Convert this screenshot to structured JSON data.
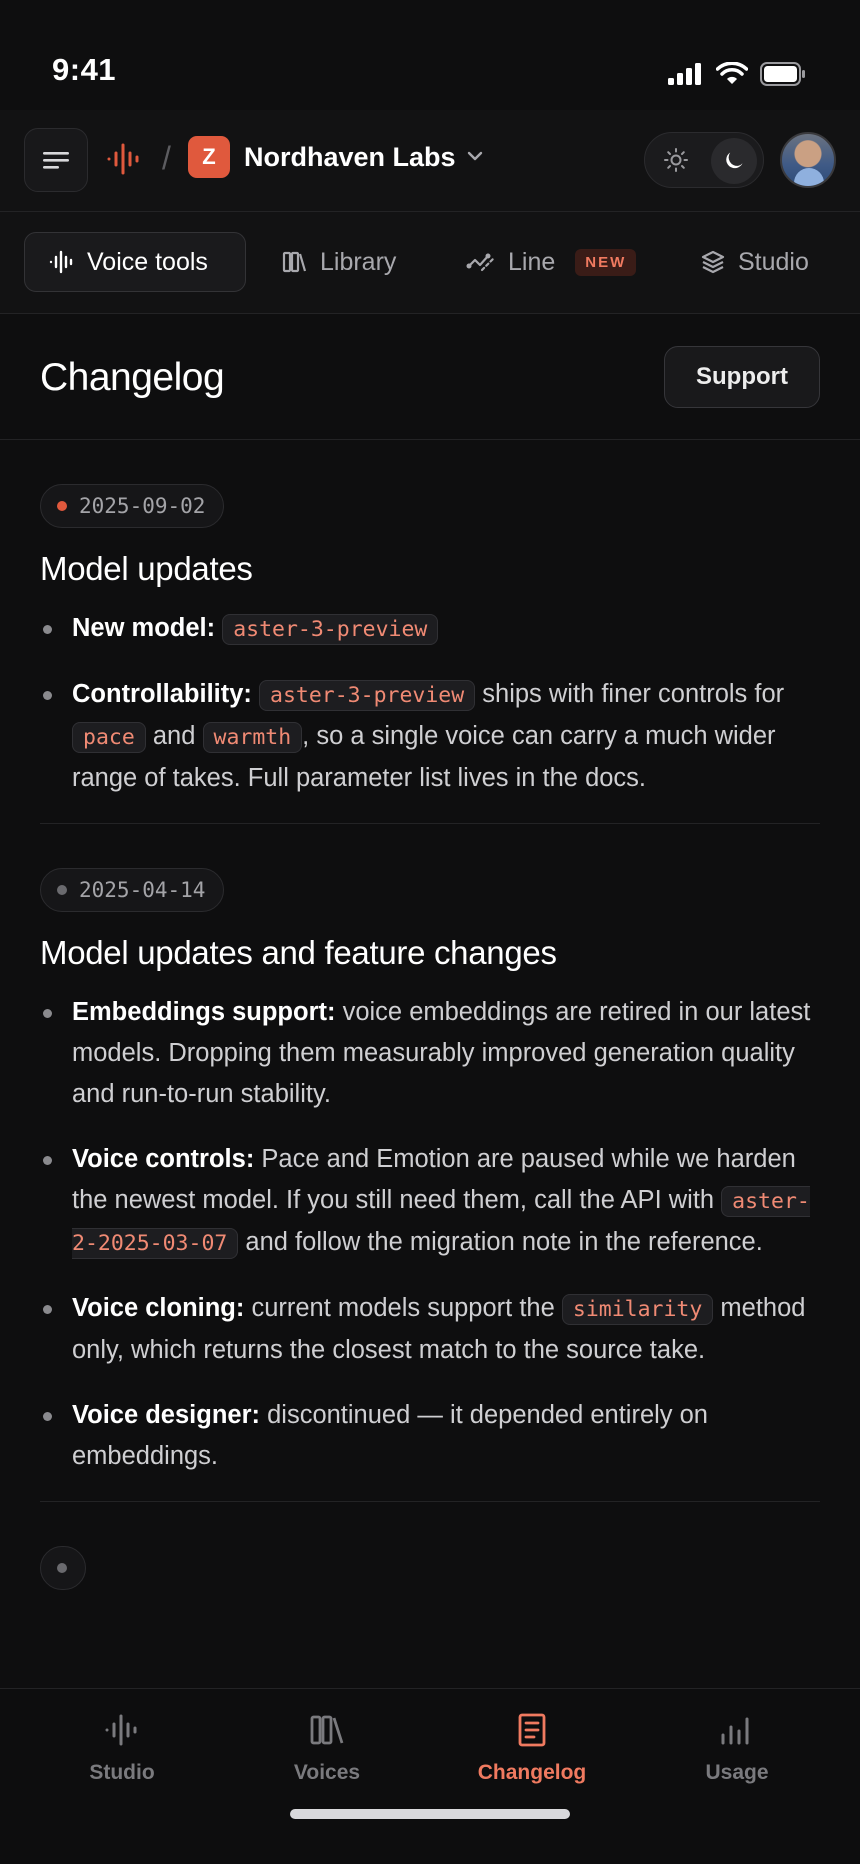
{
  "status_bar": {
    "time": "9:41"
  },
  "header": {
    "org_initial": "Z",
    "org_name": "Nordhaven Labs"
  },
  "tabs": [
    {
      "label": "Voice tools",
      "icon": "waveform-icon",
      "active": true
    },
    {
      "label": "Library",
      "icon": "library-icon",
      "active": false
    },
    {
      "label": "Line",
      "icon": "line-icon",
      "active": false,
      "badge": "NEW"
    },
    {
      "label": "Studio",
      "icon": "layers-icon",
      "active": false
    }
  ],
  "page": {
    "title": "Changelog",
    "support_label": "Support"
  },
  "entries": [
    {
      "date": "2025-09-02",
      "title": "Model updates",
      "items": [
        {
          "label": "New model:",
          "code1": "aster-3-preview"
        },
        {
          "label": "Controllability:",
          "code1": "aster-3-preview",
          "t1": " ships with finer controls for ",
          "code2": "pace",
          "t2": " and ",
          "code3": "warmth",
          "t3": ", so a single voice can carry a much wider range of takes. Full parameter list lives in the docs."
        }
      ]
    },
    {
      "date": "2025-04-14",
      "title": "Model updates and feature changes",
      "items": [
        {
          "label": "Embeddings support:",
          "text": " voice embeddings are retired in our latest models. Dropping them measurably improved generation quality and run-to-run stability."
        },
        {
          "label": "Voice controls:",
          "t1": " Pace and Emotion are paused while we harden the newest model. If you still need them, call the API with ",
          "code1": "aster-2-2025-03-07",
          "t2": " and follow the migration note in the reference."
        },
        {
          "label": "Voice cloning:",
          "t1": " current models support the ",
          "code1": "similarity",
          "t2": " method only, which returns the closest match to the source take."
        },
        {
          "label": "Voice designer:",
          "text": " discontinued — it depended entirely on embeddings."
        }
      ]
    }
  ],
  "bottom_nav": [
    {
      "label": "Studio",
      "icon": "waveform-icon",
      "active": false
    },
    {
      "label": "Voices",
      "icon": "library-icon",
      "active": false
    },
    {
      "label": "Changelog",
      "icon": "document-icon",
      "active": true
    },
    {
      "label": "Usage",
      "icon": "bar-chart-icon",
      "active": false
    }
  ],
  "colors": {
    "accent": "#e0593d",
    "background": "#0e0e0f"
  }
}
